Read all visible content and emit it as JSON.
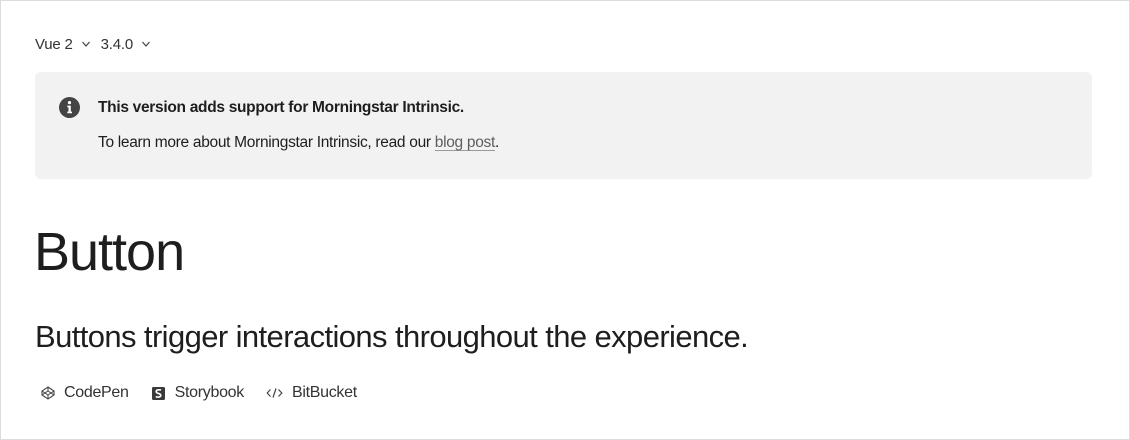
{
  "version_bar": {
    "framework": "Vue 2",
    "version": "3.4.0"
  },
  "notice": {
    "icon": "info-circle-icon",
    "title": "This version adds support for Morningstar Intrinsic.",
    "body_prefix": "To learn more about Morningstar Intrinsic, read our ",
    "link_text": "blog post",
    "body_suffix": "."
  },
  "page": {
    "title": "Button",
    "lede": "Buttons trigger interactions throughout the experience."
  },
  "resource_links": [
    {
      "label": "CodePen",
      "icon": "codepen-icon"
    },
    {
      "label": "Storybook",
      "icon": "storybook-icon"
    },
    {
      "label": "BitBucket",
      "icon": "code-icon"
    }
  ],
  "colors": {
    "text": "#1e1e1e",
    "notice_background": "#f2f2f2",
    "border": "#dcdcdc",
    "link_muted": "#5e5e5e"
  }
}
